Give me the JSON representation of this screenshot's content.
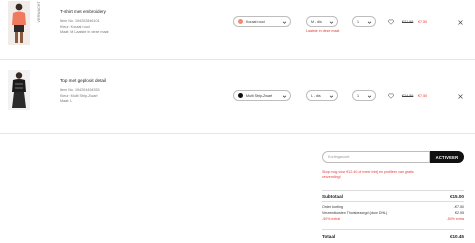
{
  "items": [
    {
      "badge": "VERWACHT",
      "name": "T-shirt met embroidery",
      "item_no": "Item No. 194202846101",
      "color": "Kleur: Koraal rood",
      "size_line": "Maat: M Laatste in deze maat",
      "color_select": "Koraal rood",
      "size_select": "M - dis",
      "qty": "1",
      "warning": "Laatste in deze maat",
      "old_price": "€21.99",
      "new_price": "€7.50"
    },
    {
      "name": "Top met geplooit detail",
      "item_no": "Item No. 194204494353",
      "color": "Kleur: Multi Strip-Zwart",
      "size_line": "Maat: L",
      "color_select": "Multi Strip-Zwart",
      "size_select": "L - dis",
      "qty": "1",
      "old_price": "€24.99",
      "new_price": "€7.50"
    }
  ],
  "discount": {
    "placeholder": "Kortingscode",
    "button": "ACTIVEER"
  },
  "promo_text": "Shop nog voor €12.40 of meer inbij en profiteer van gratis verzending!",
  "summary": {
    "subtotal_label": "Subtotaal",
    "subtotal_value": "€15.00",
    "order_discount_label": "Order korting",
    "order_discount_value": "-€7.50",
    "shipping_label": "Verzendkosten Thuisbezorgd (door DHL)",
    "shipping_value": "€2.95",
    "extra_label": "-50% extra!",
    "extra_value": "-50% extra",
    "total_label": "Totaal",
    "total_value": "€10.45"
  },
  "colors": {
    "accent_red": "#e53935",
    "swatch_coral": "#f28b72",
    "swatch_black": "#111111",
    "button_black": "#111111"
  }
}
